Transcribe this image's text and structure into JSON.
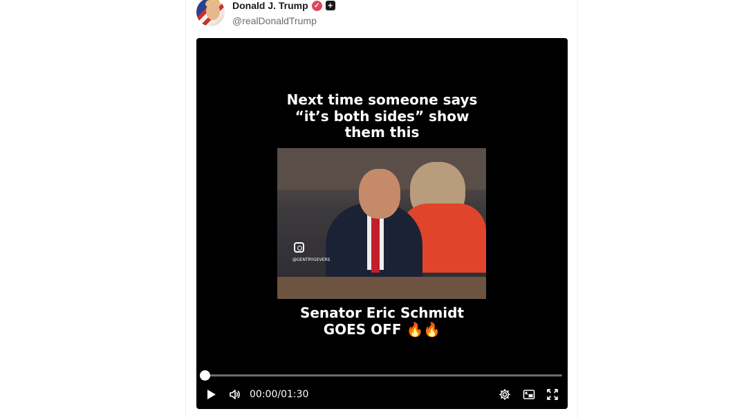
{
  "post": {
    "author_name": "Donald J. Trump",
    "handle": "@realDonaldTrump",
    "verified_icon": "verified-badge-icon",
    "plus_icon": "plus-badge-icon"
  },
  "video": {
    "caption_top": [
      "Next time someone says",
      "“it’s both sides” show",
      "them this"
    ],
    "caption_bottom": [
      "Senator Eric Schmidt",
      "GOES OFF 🔥🔥"
    ],
    "watermark": "@GENTRYGEVERS",
    "current_time": "00:00",
    "duration": "01:30",
    "progress": 0
  },
  "colors": {
    "verified": "#e0455e",
    "video_bg": "#000000"
  }
}
